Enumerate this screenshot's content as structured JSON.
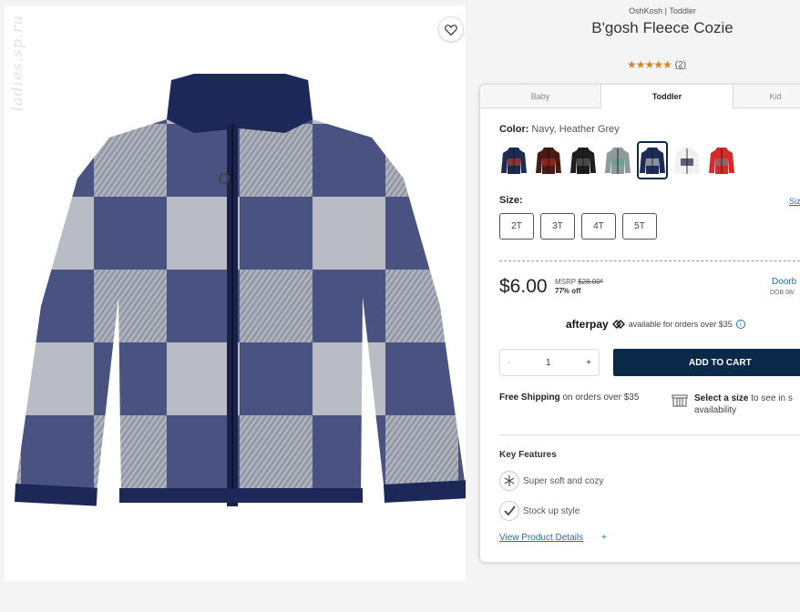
{
  "image": {
    "watermark": "ladies.sp.ru",
    "alt": "Navy, Heather Grey buffalo check fleece zip jacket"
  },
  "product": {
    "brand": "OshKosh | Toddler",
    "title": "B'gosh Fleece Cozie",
    "rating_stars": "★★★★★",
    "review_count": "(2)"
  },
  "tabs": [
    {
      "label": "Baby",
      "active": false
    },
    {
      "label": "Toddler",
      "active": true
    },
    {
      "label": "Kid",
      "active": false
    }
  ],
  "color": {
    "label": "Color:",
    "value": "Navy, Heather Grey",
    "swatches": [
      {
        "name": "navy-print",
        "body": "#1d2b52",
        "accent": "#c0392b"
      },
      {
        "name": "red-plaid",
        "body": "#4a1a14",
        "accent": "#a52a1e"
      },
      {
        "name": "black-camo",
        "body": "#1d1d1d",
        "accent": "#5c5c5c"
      },
      {
        "name": "grey-print",
        "body": "#8f9a9b",
        "accent": "#5fa088"
      },
      {
        "name": "navy-grey-check",
        "body": "#1f2b57",
        "accent": "#b9bdc6",
        "selected": true
      },
      {
        "name": "navy-white-block",
        "body": "#f0f0f0",
        "accent": "#1a2540"
      },
      {
        "name": "red-grey-block",
        "body": "#d62a2a",
        "accent": "#7b7b7b"
      }
    ]
  },
  "size": {
    "label": "Size:",
    "chart_link": "Size",
    "options": [
      "2T",
      "3T",
      "4T",
      "5T"
    ]
  },
  "pricing": {
    "price": "$6.00",
    "msrp_label": "MSRP",
    "msrp_value": "$28.00*",
    "discount": "77% off",
    "promo": "Doorb",
    "promo_sub": "DOB 08/"
  },
  "afterpay": {
    "logo": "afterpay",
    "text": "available for orders over $35",
    "info": "i"
  },
  "cart": {
    "qty_minus": "-",
    "qty_value": "1",
    "qty_plus": "+",
    "add_label": "ADD TO CART"
  },
  "shipping": {
    "bold": "Free Shipping",
    "text": "on orders over $35",
    "store_bold": "Select a size",
    "store_text": "to see in s",
    "store_text2": "availability"
  },
  "features": {
    "title": "Key Features",
    "items": [
      "Super soft and cozy",
      "Stock up style"
    ],
    "details_link": "View Product Details",
    "details_plus": "+"
  }
}
